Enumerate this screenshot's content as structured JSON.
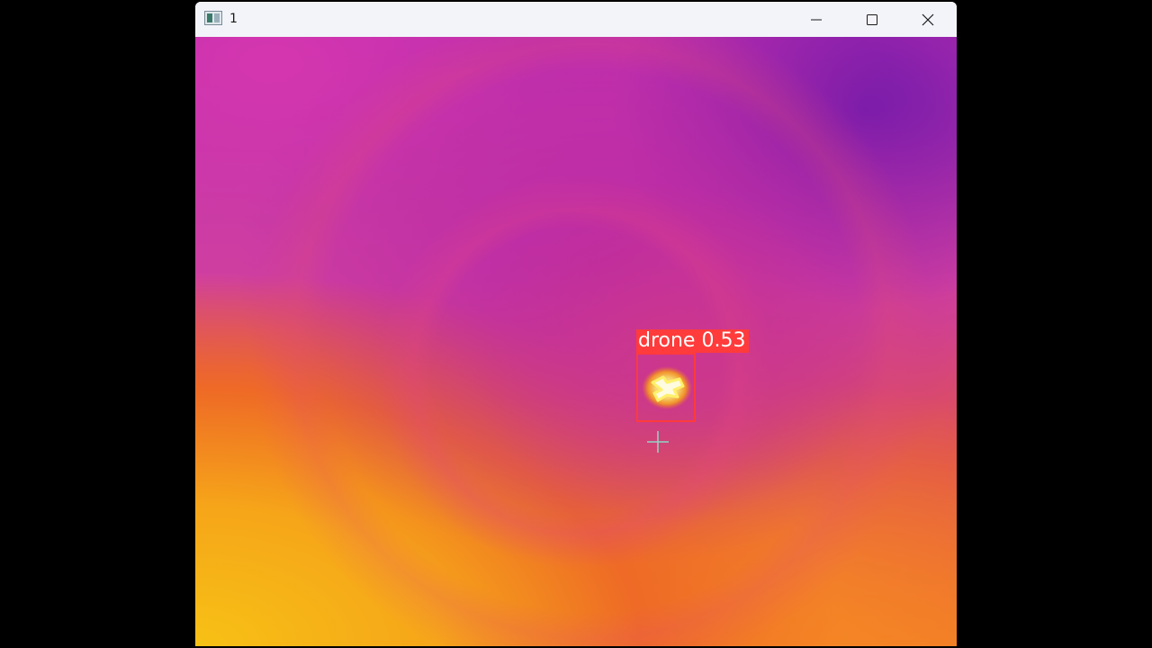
{
  "window": {
    "title": "1",
    "controls": {
      "minimize_icon": "minimize-icon",
      "maximize_icon": "maximize-icon",
      "close_icon": "close-icon"
    }
  },
  "viewer": {
    "detection": {
      "label": "drone 0.53",
      "color": "#ff3b3b"
    },
    "crosshair_color": "#8fd6c8",
    "palette": [
      "#f7c115",
      "#f07128",
      "#cf3fa0",
      "#6e19aa"
    ]
  }
}
